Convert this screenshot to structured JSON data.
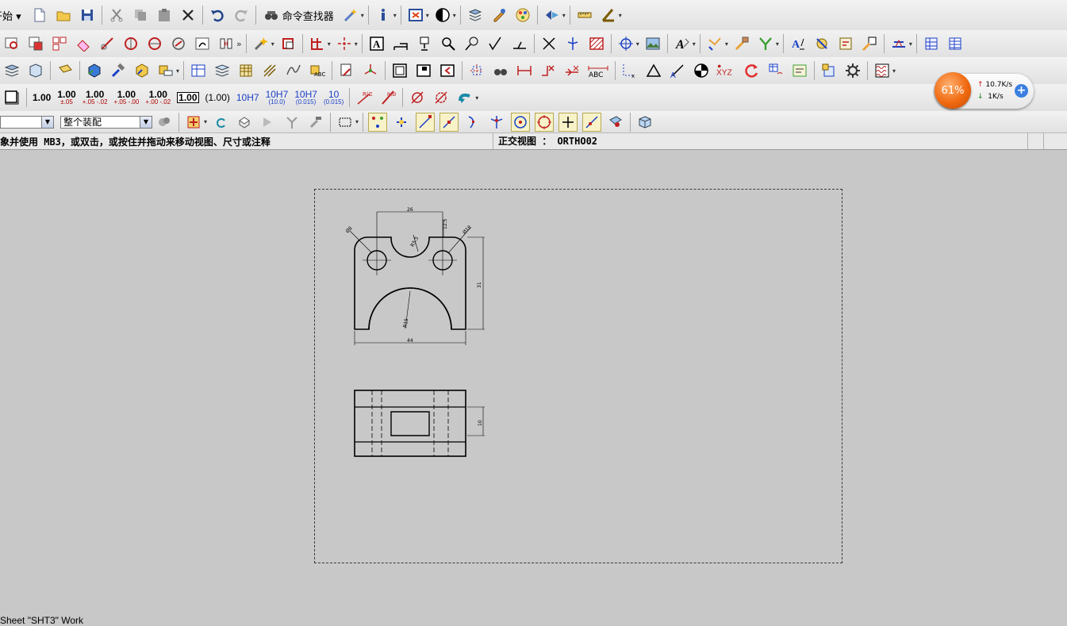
{
  "toolbar": {
    "start_label": "开始",
    "command_finder_label": "命令查找器"
  },
  "tolerance_buttons": [
    {
      "main": "1.00",
      "sub": ""
    },
    {
      "main": "1.00",
      "sub": "±.05"
    },
    {
      "main": "1.00",
      "sub": "+.05 -.02"
    },
    {
      "main": "1.00",
      "sub": "+.05 -.00"
    },
    {
      "main": "1.00",
      "sub": "+.00 -.02"
    },
    {
      "main": "1.00",
      "sub": ""
    },
    {
      "main": "(1.00)",
      "sub": ""
    }
  ],
  "fit_buttons": [
    {
      "main": "10H7",
      "sub": ""
    },
    {
      "main": "10H7",
      "sub": "(10.0)"
    },
    {
      "main": "10H7",
      "sub": "(0.015)"
    },
    {
      "main": "10",
      "sub": "(0.015)"
    }
  ],
  "selection": {
    "filter_value": "",
    "scope_value": "整个装配"
  },
  "cue_line": {
    "message": "象并使用 MB3，或双击，或按住并拖动来移动视图、尺寸或注释",
    "view_label": "正交视图 ： ORTHO02"
  },
  "drawing": {
    "top_width_dim": "26",
    "left_hole_dim": "Ø8",
    "slot_radius_dim": "R5.5",
    "upper_small_dim": "12.5",
    "right_hole_dim": "Ø18",
    "height_dim": "31",
    "arc_radius_dim": "R15",
    "base_width_dim": "44",
    "thickness_dim": "10"
  },
  "net_widget": {
    "percent": "61%",
    "upload": "10.7K/s",
    "download": "1K/s",
    "accent": "#f06a10"
  },
  "status_bar": {
    "text": "Sheet \"SHT3\" Work"
  }
}
